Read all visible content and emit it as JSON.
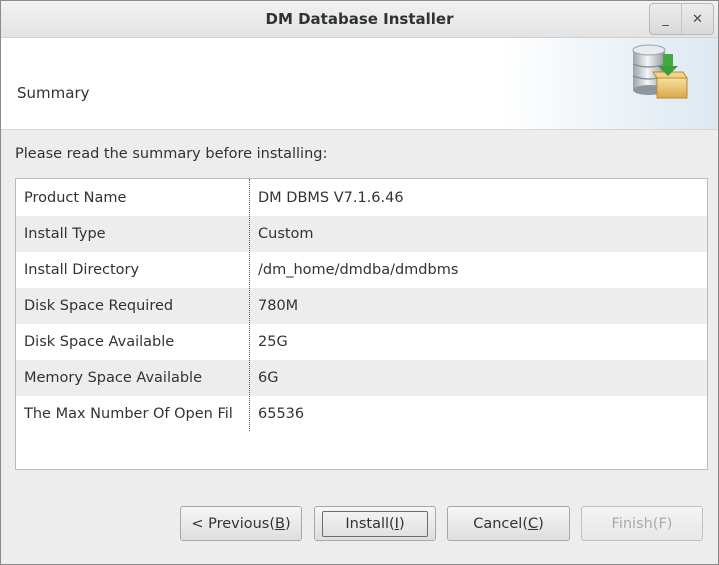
{
  "window": {
    "title": "DM Database Installer",
    "minimize_glyph": "_",
    "close_glyph": "✕"
  },
  "banner": {
    "title": "Summary",
    "logo_icon": "database-install-icon"
  },
  "intro_text": "Please read the summary before installing:",
  "summary": {
    "rows": [
      {
        "key": "Product Name",
        "value": "DM DBMS V7.1.6.46"
      },
      {
        "key": "Install Type",
        "value": "Custom"
      },
      {
        "key": "Install Directory",
        "value": "/dm_home/dmdba/dmdbms"
      },
      {
        "key": "Disk Space Required",
        "value": "780M"
      },
      {
        "key": "Disk Space Available",
        "value": "25G"
      },
      {
        "key": "Memory Space Available",
        "value": "6G"
      },
      {
        "key": "The Max Number Of Open Fil",
        "value": "65536"
      }
    ]
  },
  "buttons": {
    "previous": {
      "label": "< Previous(",
      "mnemonic": "B",
      "suffix": ")"
    },
    "install": {
      "label": "Install(",
      "mnemonic": "I",
      "suffix": ")"
    },
    "cancel": {
      "label": "Cancel(",
      "mnemonic": "C",
      "suffix": ")"
    },
    "finish": {
      "label": "Finish(F)"
    }
  },
  "colors": {
    "window_bg": "#ededed",
    "banner_accent": "#dde8f1",
    "row_alt": "#ededed"
  }
}
